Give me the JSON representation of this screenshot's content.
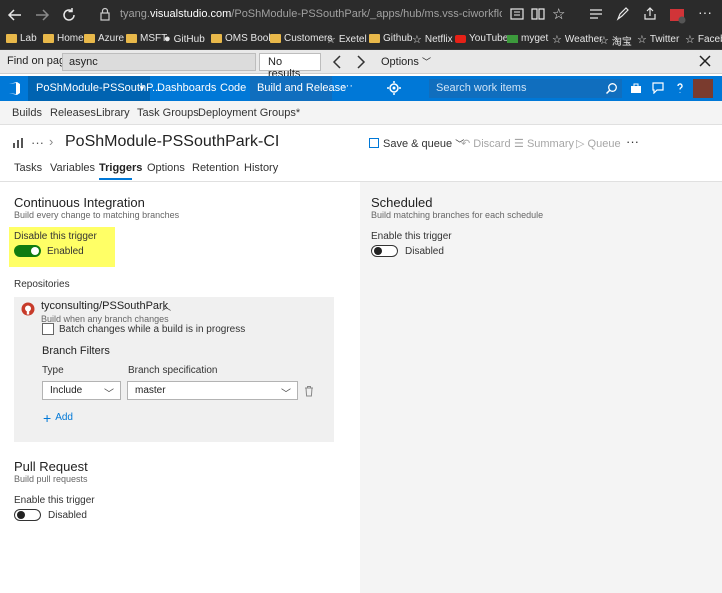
{
  "browser": {
    "url_prefix": "tyang.",
    "url_host": "visualstudio.com",
    "url_path": "/PoShModule-PSSouthPark/_apps/hub/ms.vss-ciworkflow.build-ci-hub?_a=create-bu",
    "bookmarks": [
      "Lab",
      "Home",
      "Azure",
      "MSFT",
      "GitHub",
      "OMS Book",
      "Customers",
      "Exetel",
      "Github",
      "Netflix",
      "YouTube",
      "myget",
      "Weather",
      "淘宝",
      "Twitter",
      "Faceb"
    ]
  },
  "findbar": {
    "label": "Find on page",
    "query": "async",
    "results": "No results",
    "options": "Options"
  },
  "vsts": {
    "project": "PoShModule-PSSouthP...",
    "nav": [
      "Dashboards",
      "Code",
      "Build and Release",
      "···"
    ],
    "search_placeholder": "Search work items",
    "subnav": [
      "Builds",
      "Releases",
      "Library",
      "Task Groups",
      "Deployment Groups*"
    ]
  },
  "definition": {
    "ellipsis": "···",
    "title": "PoShModule-PSSouthPark-CI",
    "toolbar": {
      "save": "Save & queue",
      "discard": "Discard",
      "summary": "Summary",
      "queue": "Queue",
      "more": "···"
    },
    "tabs": [
      "Tasks",
      "Variables",
      "Triggers",
      "Options",
      "Retention",
      "History"
    ]
  },
  "ci": {
    "title": "Continuous Integration",
    "subtitle": "Build every change to matching branches",
    "toggle_label": "Disable this trigger",
    "toggle_state": "Enabled",
    "repositories_label": "Repositories",
    "repo_name": "tyconsulting/PSSouthPark",
    "repo_sub": "Build when any branch changes",
    "batch_label": "Batch changes while a build is in progress",
    "branch_filters": "Branch Filters",
    "type_label": "Type",
    "type_value": "Include",
    "branch_spec_label": "Branch specification",
    "branch_spec_value": "master",
    "add_label": "Add"
  },
  "pr": {
    "title": "Pull Request",
    "subtitle": "Build pull requests",
    "toggle_label": "Enable this trigger",
    "toggle_state": "Disabled"
  },
  "scheduled": {
    "title": "Scheduled",
    "subtitle": "Build matching branches for each schedule",
    "toggle_label": "Enable this trigger",
    "toggle_state": "Disabled"
  },
  "colors": {
    "accent": "#0078d7",
    "toggle_on": "#107c10",
    "highlight": "#ffff66"
  }
}
